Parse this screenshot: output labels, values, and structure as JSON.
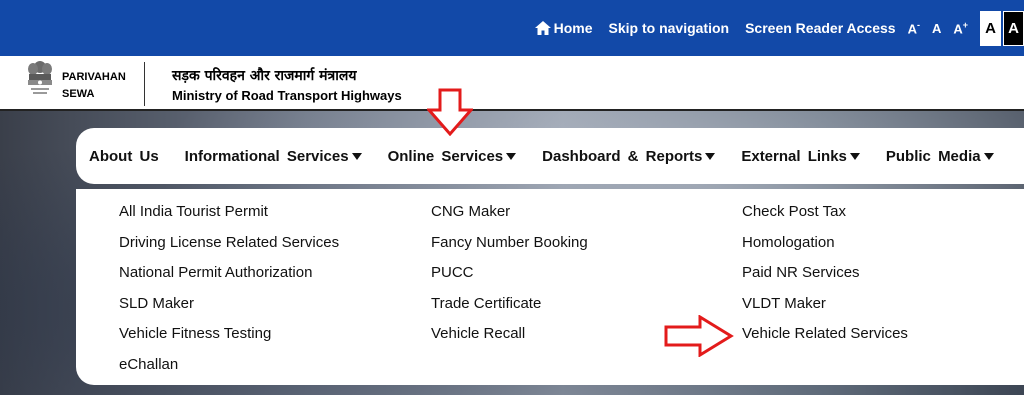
{
  "topbar": {
    "home": "Home",
    "skip": "Skip to navigation",
    "screen_reader": "Screen Reader Access",
    "font_smaller": "A",
    "font_smaller_sup": "-",
    "font_normal": "A",
    "font_larger": "A",
    "font_larger_sup": "+",
    "contrast_light": "A",
    "contrast_dark": "A"
  },
  "header": {
    "brand_line1": "PARIVAHAN",
    "brand_line2": "SEWA",
    "hindi_title": "सड़क परिवहन और राजमार्ग मंत्रालय",
    "ministry": "Ministry of Road Transport Highways"
  },
  "nav": {
    "items": [
      {
        "label": "About Us",
        "has_caret": false
      },
      {
        "label": "Informational Services",
        "has_caret": true
      },
      {
        "label": "Online Services",
        "has_caret": true
      },
      {
        "label": "Dashboard & Reports",
        "has_caret": true
      },
      {
        "label": "External Links",
        "has_caret": true
      },
      {
        "label": "Public Media",
        "has_caret": true
      }
    ]
  },
  "dropdown": {
    "col1": [
      "All India Tourist Permit",
      "Driving License Related Services",
      "National Permit Authorization",
      "SLD Maker",
      "Vehicle Fitness Testing",
      "eChallan"
    ],
    "col2": [
      "CNG Maker",
      "Fancy Number Booking",
      "PUCC",
      "Trade Certificate",
      "Vehicle Recall"
    ],
    "col3": [
      "Check Post Tax",
      "Homologation",
      "Paid NR Services",
      "VLDT Maker",
      "Vehicle Related Services"
    ]
  },
  "colors": {
    "topbar_bg": "#1249a8",
    "annotation_arrow": "#e31b1b"
  },
  "icons": {
    "home": "home-icon",
    "caret": "caret-down-icon",
    "emblem": "national-emblem-icon"
  }
}
